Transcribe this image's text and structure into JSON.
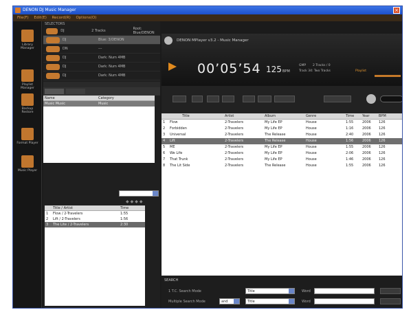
{
  "window": {
    "title": "DENON DJ Music Manager"
  },
  "menu": [
    "File(F)",
    "Edit(E)",
    "Record(R)",
    "Options(O)"
  ],
  "left_nav": [
    {
      "label": "Library Manager",
      "icon": "library-icon"
    },
    {
      "label": "Playlist Manager",
      "icon": "playlist-icon"
    },
    {
      "label": "Backup Restore",
      "icon": "backup-icon"
    },
    {
      "label": "Format Player",
      "icon": "format-icon"
    },
    {
      "label": "Music Player",
      "icon": "music-player-icon"
    }
  ],
  "selectors": {
    "title": "SELECTORS",
    "devices": [
      {
        "c1": "DJ",
        "c2": "2 Tracks",
        "c3": "Root: Blue/DENON",
        "sel": false
      },
      {
        "c1": "DJ",
        "c2": "Blue: 3/DENON",
        "c3": "",
        "sel": true
      },
      {
        "c1": "DN",
        "c2": "---",
        "c3": "",
        "sel": false
      },
      {
        "c1": "DJ",
        "c2": "Dark: Num 4MB",
        "c3": "",
        "sel": false
      },
      {
        "c1": "DJ",
        "c2": "Dark: Num 4MB",
        "c3": "",
        "sel": false
      },
      {
        "c1": "DJ",
        "c2": "Dark: Num 4MB",
        "c3": "",
        "sel": false
      }
    ]
  },
  "category_table": {
    "headers": [
      "Name",
      "Category"
    ],
    "rows": [
      [
        "Music Music",
        "Music"
      ]
    ]
  },
  "playlist_table": {
    "headers": [
      "",
      "Title / Artist",
      "Time"
    ],
    "rows": [
      [
        "1",
        "Flow / 2-Travelers",
        "1:55",
        false
      ],
      [
        "2",
        "Lift / 2-Travelers",
        "1:56",
        false
      ],
      [
        "3",
        "The Lite / 2-Travelers",
        "2:30",
        true
      ]
    ]
  },
  "player": {
    "title": "DENON MPlayer v3.2 - Music Manager",
    "time": "00’05’54",
    "bpm": "125",
    "bpm_unit": "BPM",
    "side": [
      "GMP",
      "2 Tracks / 0",
      "Track 34: Two Tracks",
      "Playlist"
    ]
  },
  "tracks": {
    "headers": [
      "",
      "Title",
      "Artist",
      "Album",
      "Genre",
      "Time",
      "Year",
      "BPM"
    ],
    "rows": [
      [
        "1",
        "Flow",
        "2-Travelers",
        "My Life EP",
        "House",
        "1:55",
        "2006",
        "126",
        false
      ],
      [
        "2",
        "Forbidden",
        "2-Travelers",
        "My Life EP",
        "House",
        "1:16",
        "2006",
        "126",
        false
      ],
      [
        "3",
        "Universal",
        "2-Travelers",
        "The Release",
        "House",
        "2:40",
        "2006",
        "126",
        false
      ],
      [
        "4",
        "Lift",
        "2-Travelers",
        "The Release",
        "House",
        "1:56",
        "2006",
        "126",
        true
      ],
      [
        "5",
        "ME",
        "2-Travelers",
        "My Life EP",
        "House",
        "1:55",
        "2006",
        "126",
        false
      ],
      [
        "6",
        "We Life",
        "2-Travelers",
        "My Life EP",
        "House",
        "2:06",
        "2006",
        "126",
        false
      ],
      [
        "7",
        "That Trunk",
        "2-Travelers",
        "My Life EP",
        "House",
        "1:46",
        "2006",
        "126",
        false
      ],
      [
        "8",
        "The Lit Side",
        "2-Travelers",
        "The Release",
        "House",
        "1:55",
        "2006",
        "126",
        false
      ]
    ]
  },
  "search": {
    "title": "SEARCH",
    "row1_label": "1 T.C. Search Mode",
    "row2_label": "Multiple Search Mode",
    "field1": "Title",
    "field2": "Title",
    "op": "and",
    "word_label": "Word"
  }
}
